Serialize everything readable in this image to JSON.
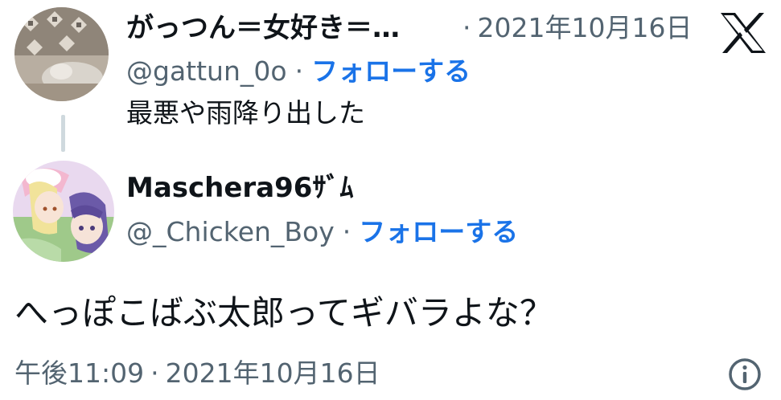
{
  "quoted_tweet": {
    "author_name": "がっつん＝女好き＝…",
    "date_separator": "·",
    "date": "2021年10月16日",
    "handle": "@gattun_0o",
    "separator": "·",
    "follow_label": "フォローする",
    "text": "最悪や雨降り出した"
  },
  "reply_tweet": {
    "author_name": "Maschera96ｻﾞﾑ",
    "handle": "@_Chicken_Boy",
    "separator": "·",
    "follow_label": "フォローする",
    "text": "へっぽこばぶ太郎ってギバラよな？",
    "time": "午後11:09",
    "time_separator": "·",
    "date": "2021年10月16日"
  },
  "icons": {
    "platform_logo": "x-logo-icon",
    "info": "info-icon"
  },
  "colors": {
    "text_primary": "#0f1419",
    "text_secondary": "#536471",
    "follow_link": "#1a73e8",
    "thread_line": "#cfd9de"
  }
}
